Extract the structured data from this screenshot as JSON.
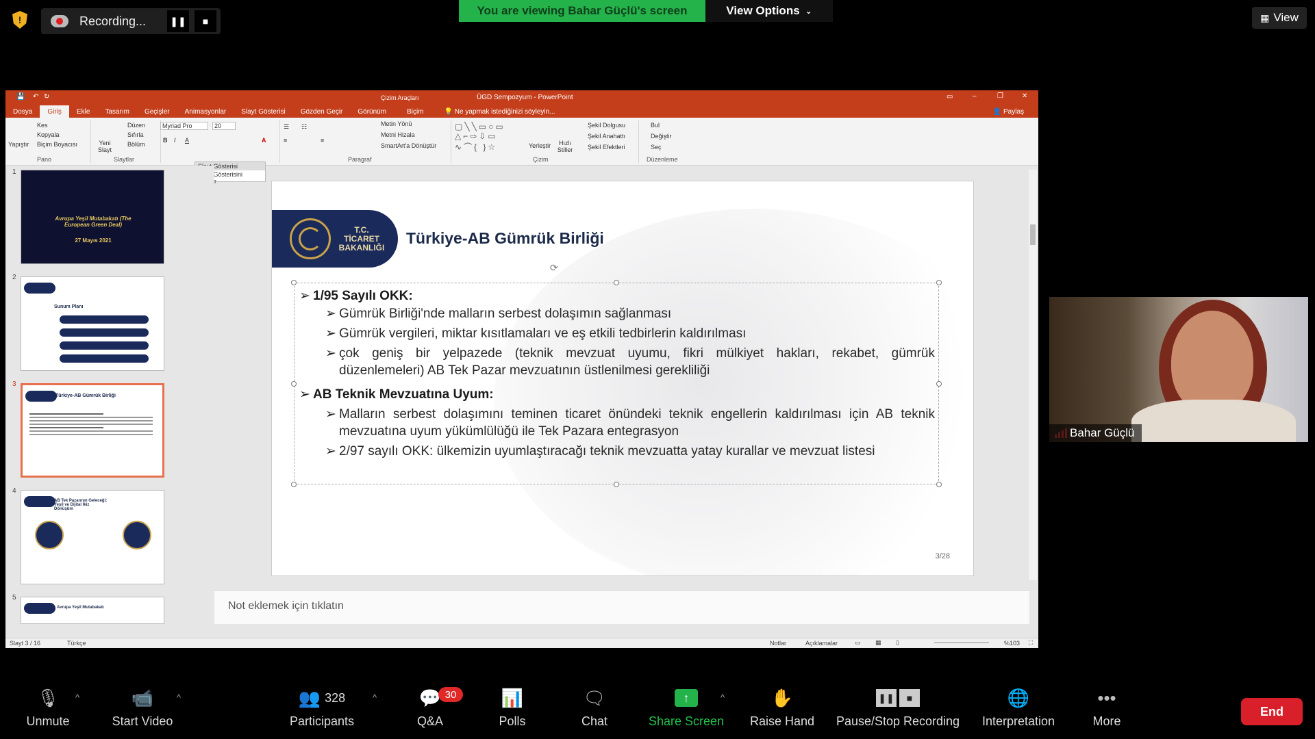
{
  "top": {
    "recording_label": "Recording...",
    "viewing_prefix": "You are viewing Bahar Güçlü's screen",
    "view_options": "View Options",
    "view": "View"
  },
  "ppt": {
    "context_tab": "Çizim Araçları",
    "window_title": "ÜGD Sempozyum - PowerPoint",
    "tabs": [
      "Dosya",
      "Giriş",
      "Ekle",
      "Tasarım",
      "Geçişler",
      "Animasyonlar",
      "Slayt Gösterisi",
      "Gözden Geçir",
      "Görünüm",
      "Biçim"
    ],
    "tell_me": "Ne yapmak istediğinizi söyleyin...",
    "share": "Paylaş",
    "ribbon": {
      "paste": "Yapıştır",
      "cut": "Kes",
      "copy": "Kopyala",
      "format_painter": "Biçim Boyacısı",
      "pano": "Pano",
      "new_slide": "Yeni Slayt",
      "layout": "Düzen",
      "reset": "Sıfırla",
      "section": "Bölüm",
      "slaytlar": "Slaytlar",
      "font": "Myriad Pro",
      "size": "20",
      "paragraf": "Paragraf",
      "text_dir": "Metin Yönü",
      "align_text": "Metni Hizala",
      "smartart": "SmartArt'a Dönüştür",
      "arrange": "Yerleştir",
      "quick_styles": "Hızlı Stiller",
      "shape_fill": "Şekil Dolgusu",
      "shape_outline": "Şekil Anahattı",
      "shape_effects": "Şekil Efektleri",
      "cizim": "Çizim",
      "find": "Bul",
      "replace": "Değiştir",
      "select": "Seç",
      "duzenleme": "Düzenleme"
    },
    "slideshow_popup": {
      "title": "Slayt Gösterisi",
      "resume": "Slayt Gösterisini Sürdür"
    },
    "thumbs": [
      {
        "num": "1",
        "title": "Avrupa Yeşil Mutabakatı (The European Green Deal)",
        "date": "27 Mayıs 2021"
      },
      {
        "num": "2",
        "title": "Sunum Planı"
      },
      {
        "num": "3",
        "title": "Türkiye-AB Gümrük Birliği"
      },
      {
        "num": "4",
        "title": "AB Tek Pazarının Geleceği: Yeşil ve Dijital İkiz Dönüşüm"
      },
      {
        "num": "5",
        "title": "Avrupa Yeşil Mutabakatı"
      }
    ],
    "slide": {
      "logo_text": "T.C. TİCARET BAKANLIĞI",
      "title": "Türkiye-AB Gümrük Birliği",
      "b1": "1/95 Sayılı OKK:",
      "b1_1": "Gümrük Birliği'nde malların serbest dolaşımın sağlanması",
      "b1_2": "Gümrük vergileri, miktar kısıtlamaları ve eş etkili tedbirlerin kaldırılması",
      "b1_3a": "çok geniş bir yelpazede (teknik mevzuat uyumu, fikri mülkiyet hakları, rekabet, gümrük",
      "b1_3b": "düzenlemeleri) AB Tek Pazar mevzuatının üstlenilmesi gerekliliği",
      "b2": "AB Teknik Mevzuatına Uyum:",
      "b2_1a": "Malların serbest dolaşımını teminen  ticaret önündeki teknik engellerin kaldırılması için AB teknik",
      "b2_1b": "mevzuatına uyum yükümlülüğü ile Tek Pazara entegrasyon",
      "b2_2": "2/97 sayılı OKK: ülkemizin uyumlaştıracağı teknik mevzuatta yatay kurallar ve mevzuat listesi",
      "page": "3/28"
    },
    "notes_placeholder": "Not eklemek için tıklatın",
    "status": {
      "slide": "Slayt 3 / 16",
      "lang": "Türkçe",
      "notes": "Notlar",
      "comments": "Açıklamalar",
      "zoom": "%103"
    }
  },
  "cam": {
    "name": "Bahar Güçlü"
  },
  "toolbar": {
    "unmute": "Unmute",
    "start_video": "Start Video",
    "participants": "Participants",
    "participant_count": "328",
    "qa": "Q&A",
    "qa_badge": "30",
    "polls": "Polls",
    "chat": "Chat",
    "share_screen": "Share Screen",
    "raise_hand": "Raise Hand",
    "pause_stop": "Pause/Stop Recording",
    "interpretation": "Interpretation",
    "more": "More",
    "end": "End"
  }
}
